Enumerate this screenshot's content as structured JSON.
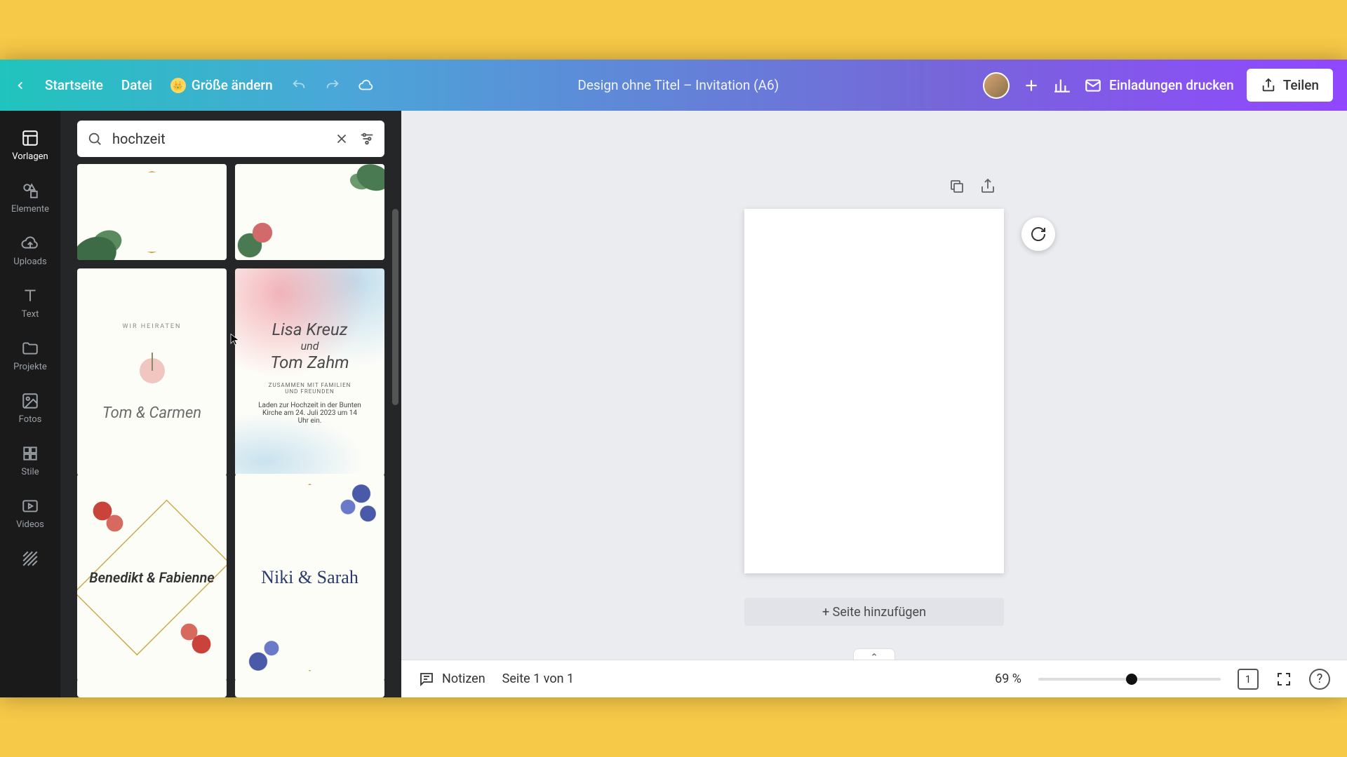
{
  "header": {
    "home": "Startseite",
    "file": "Datei",
    "resize": "Größe ändern",
    "doc_title": "Design ohne Titel – Invitation (A6)",
    "print": "Einladungen drucken",
    "share": "Teilen"
  },
  "rail": {
    "templates": "Vorlagen",
    "elements": "Elemente",
    "uploads": "Uploads",
    "text": "Text",
    "projects": "Projekte",
    "photos": "Fotos",
    "styles": "Stile",
    "videos": "Videos"
  },
  "search": {
    "value": "hochzeit"
  },
  "templates": {
    "t2_subhead": "WIR HEIRATEN",
    "t2_names": "Tom & Carmen",
    "t3_names1": "Lisa Kreuz",
    "t3_und": "und",
    "t3_names2": "Tom Zahm",
    "t3_sub1": "ZUSAMMEN MIT FAMILIEN",
    "t3_sub2": "UND FREUNDEN",
    "t3_body": "Laden zur Hochzeit in der Bunten Kirche am 24. Juli 2023 um 14 Uhr ein.",
    "t4_names": "Benedikt & Fabienne",
    "t5_names": "Niki & Sarah"
  },
  "canvas": {
    "add_page": "+ Seite hinzufügen"
  },
  "footer": {
    "notes": "Notizen",
    "page_indicator": "Seite 1 von 1",
    "zoom_label": "69 %",
    "zoom_pct": 69,
    "page_count": "1",
    "help": "?"
  }
}
